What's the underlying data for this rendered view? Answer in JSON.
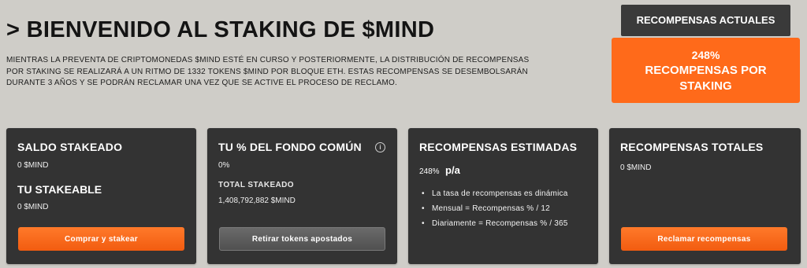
{
  "header": {
    "title": "> BIENVENIDO AL STAKING DE $MIND",
    "description": "Mientras la preventa de criptomonedas $MIND esté en curso y posteriormente, la distribución de recompensas por staking se realizará a un ritmo de 1332 tokens $MIND por bloque ETH. Estas recompensas se desembolsarán durante 3 años y se podrán reclamar una vez que se active el proceso de reclamo."
  },
  "rewards_panel": {
    "tab_label": "RECOMPENSAS ACTUALES",
    "percentage": "248%",
    "label": "RECOMPENSAS POR STAKING"
  },
  "cards": {
    "staked": {
      "title": "SALDO STAKEADO",
      "value": "0 $MIND",
      "stakeable_title": "TU STAKEABLE",
      "stakeable_value": "0 $MIND",
      "button": "Comprar y stakear"
    },
    "pool": {
      "title": "TU % DEL FONDO COMÚN",
      "info_icon": "i",
      "value": "0%",
      "total_label": "TOTAL STAKEADO",
      "total_value": "1,408,792,882 $MIND",
      "button": "Retirar tokens apostados"
    },
    "estimated": {
      "title": "RECOMPENSAS ESTIMADAS",
      "value": "248%",
      "unit": "p/a",
      "bullets": [
        "La tasa de recompensas es dinámica",
        "Mensual = Recompensas % / 12",
        "Diariamente = Recompensas % / 365"
      ]
    },
    "total": {
      "title": "RECOMPENSAS TOTALES",
      "value": "0 $MIND",
      "button": "Reclamar recompensas"
    }
  },
  "colors": {
    "accent": "#ff6a1a",
    "card_bg": "#333333",
    "page_bg": "#cfcdc8"
  }
}
